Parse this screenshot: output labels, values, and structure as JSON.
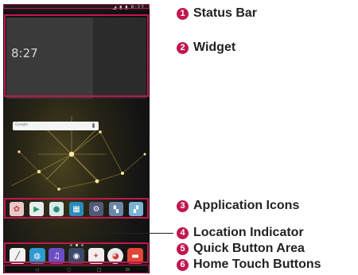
{
  "device": {
    "status_icons": "◢ ▮ ▮ 8:27",
    "clock": "8:27",
    "search_label": "Google",
    "nav_buttons": [
      "◁",
      "○",
      "□",
      "⊟"
    ]
  },
  "callouts": [
    {
      "number": "1",
      "label": "Status Bar"
    },
    {
      "number": "2",
      "label": "Widget"
    },
    {
      "number": "3",
      "label": "Application Icons"
    },
    {
      "number": "4",
      "label": "Location Indicator"
    },
    {
      "number": "5",
      "label": "Quick Button Area"
    },
    {
      "number": "6",
      "label": "Home Touch Buttons"
    }
  ],
  "colors": {
    "accent": "#c0184e",
    "label_text": "#222222"
  },
  "app_icons": [
    "gallery-icon",
    "play-store-icon",
    "contacts-icon",
    "apps-icon",
    "settings-icon",
    "tools-folder-icon",
    "misc-folder-icon"
  ],
  "dock_icons": [
    "pen-icon",
    "browser-icon",
    "music-icon",
    "camera-icon",
    "photos-icon",
    "chrome-icon",
    "messages-icon"
  ]
}
